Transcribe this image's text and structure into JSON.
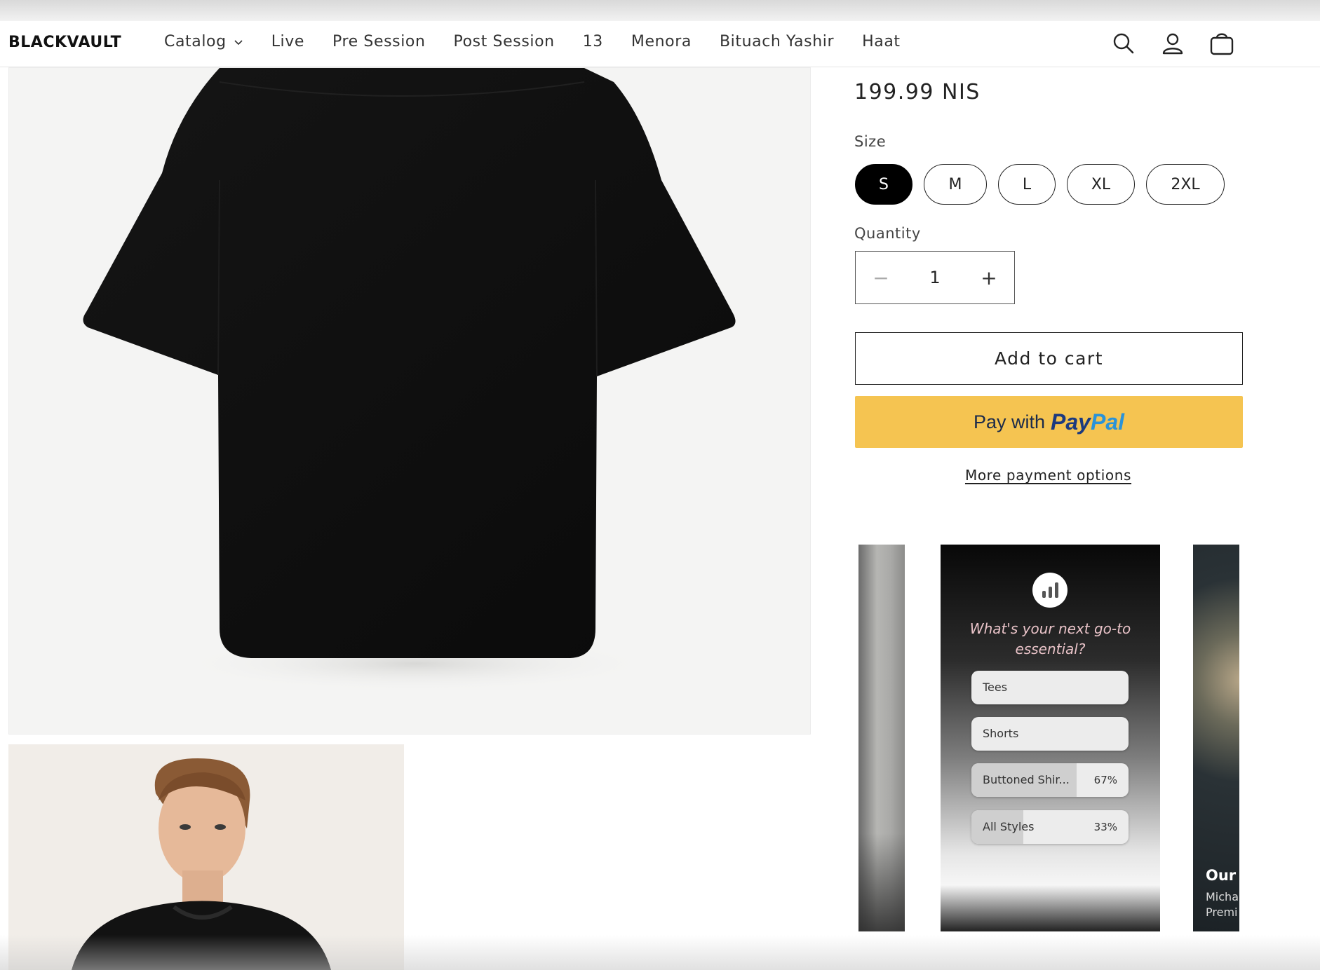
{
  "header": {
    "logo": "BLACKVAULT",
    "nav": [
      {
        "label": "Catalog",
        "has_dropdown": true
      },
      {
        "label": "Live"
      },
      {
        "label": "Pre Session"
      },
      {
        "label": "Post Session"
      },
      {
        "label": "13"
      },
      {
        "label": "Menora"
      },
      {
        "label": "Bituach Yashir"
      },
      {
        "label": "Haat"
      }
    ],
    "icons": [
      "search-icon",
      "account-icon",
      "cart-icon"
    ]
  },
  "product": {
    "price": "199.99 NIS",
    "size_label": "Size",
    "sizes": [
      "S",
      "M",
      "L",
      "XL",
      "2XL"
    ],
    "selected_size": "S",
    "quantity_label": "Quantity",
    "quantity": "1",
    "quantity_decrease": "−",
    "quantity_increase": "+",
    "add_to_cart": "Add to cart",
    "paypal": {
      "prefix": "Pay with",
      "brand_part1": "Pay",
      "brand_part2": "Pal",
      "color": "#f5c451"
    },
    "more_payment": "More payment options"
  },
  "stories": {
    "poll": {
      "question": "What's your next go-to essential?",
      "options": [
        {
          "label": "Tees",
          "percent": null,
          "percent_text": ""
        },
        {
          "label": "Shorts",
          "percent": null,
          "percent_text": ""
        },
        {
          "label": "Buttoned Shir...",
          "percent": 67,
          "percent_text": "67%"
        },
        {
          "label": "All Styles",
          "percent": 33,
          "percent_text": "33%"
        }
      ]
    },
    "right_card": {
      "title": "Our I",
      "line1": "Micha",
      "line2": "Premi"
    }
  }
}
